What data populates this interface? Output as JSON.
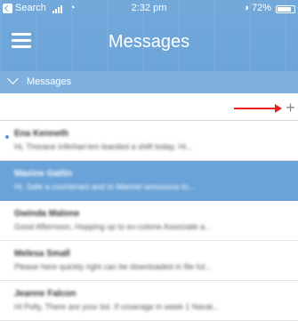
{
  "status_bar": {
    "back_label": "Search",
    "time": "2:32 pm",
    "battery": "72%"
  },
  "header": {
    "title": "Messages"
  },
  "filter": {
    "label": "Messages"
  },
  "toolbar": {
    "add_label": "+"
  },
  "messages": [
    {
      "sender": "Ena Kenneth",
      "preview": "Hi, Thorane Infinhan'em leaniled a shift today. Hi...",
      "unread": true,
      "selected": false
    },
    {
      "sender": "Maxine Gatlin",
      "preview": "Hi, Safe a counterant and to Marivel announce to...",
      "unread": false,
      "selected": true
    },
    {
      "sender": "Gwinda Malone",
      "preview": "Good Afternoon, Hopping up to ex-colone Associate a...",
      "unread": false,
      "selected": false
    },
    {
      "sender": "Melesa Small",
      "preview": "Please here quickly right can be downloaded in file ful...",
      "unread": false,
      "selected": false
    },
    {
      "sender": "Jeanne Falcon",
      "preview": "Hi Polly, There are your list. If coverage in week 1 Naval...",
      "unread": false,
      "selected": false
    }
  ]
}
